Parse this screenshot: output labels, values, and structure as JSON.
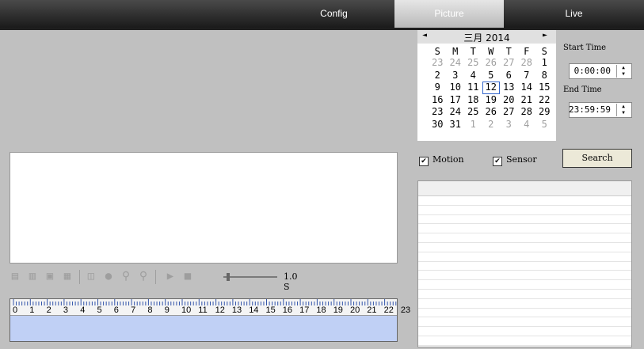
{
  "tabs": [
    {
      "label": "Config"
    },
    {
      "label": "Picture"
    },
    {
      "label": "Live"
    }
  ],
  "calendar": {
    "title": "三月 2014",
    "prev_icon": "◄",
    "next_icon": "►",
    "dows": [
      "S",
      "M",
      "T",
      "W",
      "T",
      "F",
      "S"
    ],
    "days": [
      {
        "d": "23",
        "dim": true
      },
      {
        "d": "24",
        "dim": true
      },
      {
        "d": "25",
        "dim": true
      },
      {
        "d": "26",
        "dim": true
      },
      {
        "d": "27",
        "dim": true
      },
      {
        "d": "28",
        "dim": true
      },
      {
        "d": "1"
      },
      {
        "d": "2"
      },
      {
        "d": "3"
      },
      {
        "d": "4"
      },
      {
        "d": "5"
      },
      {
        "d": "6"
      },
      {
        "d": "7"
      },
      {
        "d": "8"
      },
      {
        "d": "9"
      },
      {
        "d": "10"
      },
      {
        "d": "11"
      },
      {
        "d": "12",
        "selected": true
      },
      {
        "d": "13"
      },
      {
        "d": "14"
      },
      {
        "d": "15"
      },
      {
        "d": "16"
      },
      {
        "d": "17"
      },
      {
        "d": "18"
      },
      {
        "d": "19"
      },
      {
        "d": "20"
      },
      {
        "d": "21"
      },
      {
        "d": "22"
      },
      {
        "d": "23"
      },
      {
        "d": "24"
      },
      {
        "d": "25"
      },
      {
        "d": "26"
      },
      {
        "d": "27"
      },
      {
        "d": "28"
      },
      {
        "d": "29"
      },
      {
        "d": "30"
      },
      {
        "d": "31"
      },
      {
        "d": "1",
        "dim": true
      },
      {
        "d": "2",
        "dim": true
      },
      {
        "d": "3",
        "dim": true
      },
      {
        "d": "4",
        "dim": true
      },
      {
        "d": "5",
        "dim": true
      }
    ]
  },
  "start_time": {
    "label": "Start Time",
    "value": "0:00:00"
  },
  "end_time": {
    "label": "End Time",
    "value": "23:59:59"
  },
  "filters": {
    "motion": {
      "label": "Motion",
      "checked": true
    },
    "sensor": {
      "label": "Sensor",
      "checked": true
    }
  },
  "search_label": "Search",
  "results": {
    "row_count": 17
  },
  "toolbar": {
    "icons": [
      "copy-icon",
      "paste-icon",
      "save-icon",
      "clipboard-icon",
      "crop-icon",
      "stop-record-icon",
      "zoom-in-icon",
      "zoom-out-icon",
      "play-icon",
      "stop-icon",
      "speed-slider-icon"
    ],
    "speed": "1.0 S"
  },
  "timeline": {
    "hours": [
      "0",
      "1",
      "2",
      "3",
      "4",
      "5",
      "6",
      "7",
      "8",
      "9",
      "10",
      "11",
      "12",
      "13",
      "14",
      "15",
      "16",
      "17",
      "18",
      "19",
      "20",
      "21",
      "22",
      "23"
    ]
  },
  "colors": {
    "background": "#c0c0c0",
    "timeline_fill": "#c0d0f5",
    "topbar": "#2a2a2a"
  }
}
